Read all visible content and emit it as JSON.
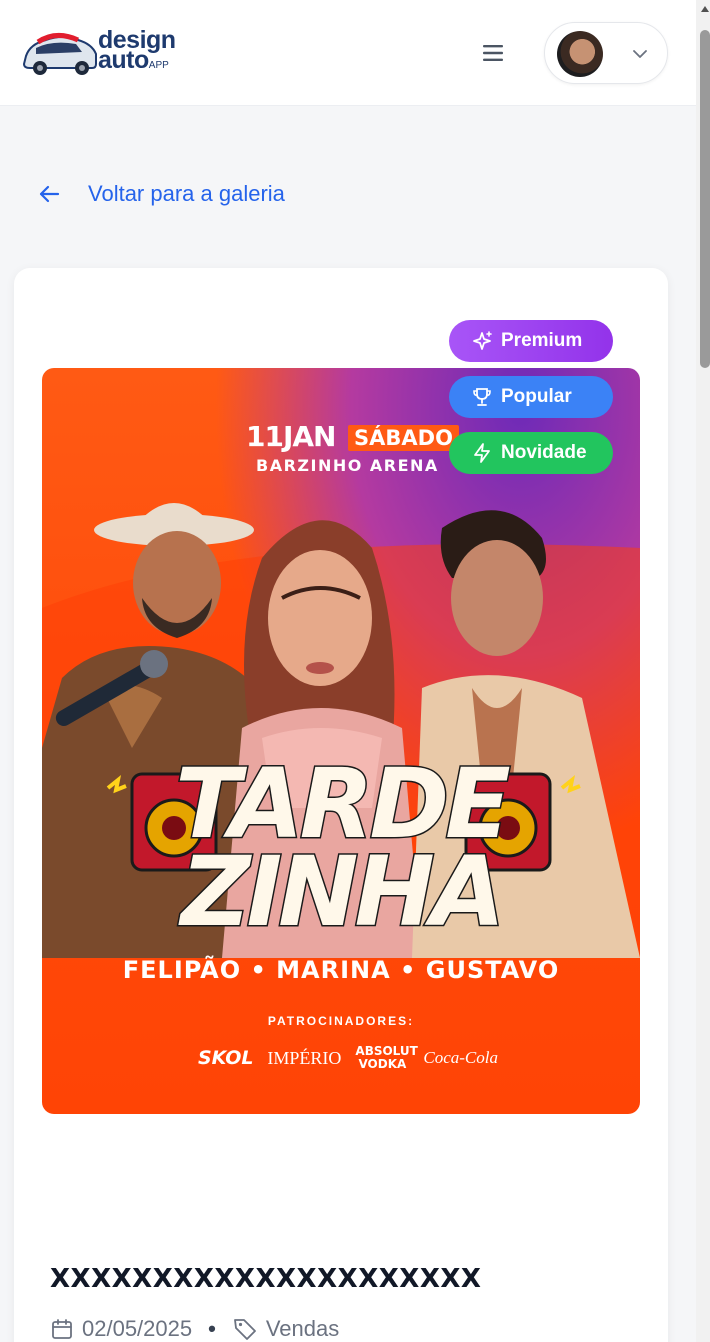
{
  "header": {
    "logo": {
      "line1": "design",
      "line2": "auto",
      "suffix": "APP"
    },
    "menu_icon": "hamburger-icon",
    "user": {
      "avatar": "user-avatar",
      "chevron": "chevron-down-icon"
    }
  },
  "nav": {
    "back_label": "Voltar para a galeria",
    "back_icon": "arrow-left-icon"
  },
  "badges": [
    {
      "label": "Premium",
      "icon": "sparkles-icon",
      "color": "#a855f7"
    },
    {
      "label": "Popular",
      "icon": "trophy-icon",
      "color": "#3b82f6"
    },
    {
      "label": "Novidade",
      "icon": "lightning-icon",
      "color": "#22c55e"
    }
  ],
  "poster": {
    "date": "11JAN",
    "day": "SÁBADO",
    "venue": "BARZINHO ARENA",
    "title_line1": "TARDE",
    "title_line2": "ZINHA",
    "artists": "FELIPÃO • MARINA • GUSTAVO",
    "sponsors_label": "PATROCINADORES:",
    "sponsors": [
      "SKOL",
      "IMPÉRIO",
      "ABSOLUT VODKA",
      "Coca-Cola"
    ]
  },
  "post": {
    "title": "XXXXXXXXXXXXXXXXXXXXX",
    "date": "02/05/2025",
    "separator": "•",
    "category": "Vendas"
  },
  "colors": {
    "accent": "#2563eb",
    "poster_orange": "#ff4a0a"
  }
}
